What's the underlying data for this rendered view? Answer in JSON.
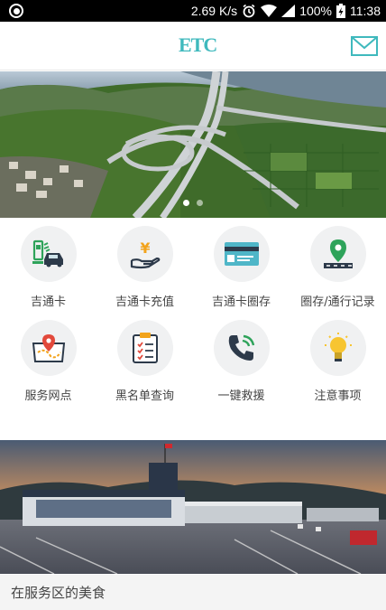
{
  "status_bar": {
    "speed": "2.69 K/s",
    "battery": "100%",
    "time": "11:38"
  },
  "header": {
    "logo": "ETC",
    "mail_icon": "mail-icon"
  },
  "banner": {
    "slides": 2,
    "active_slide": 1
  },
  "grid": [
    {
      "label": "吉通卡",
      "icon": "etc-card-car-icon"
    },
    {
      "label": "吉通卡充值",
      "icon": "yen-hand-icon"
    },
    {
      "label": "吉通卡圈存",
      "icon": "card-icon"
    },
    {
      "label": "圈存/通行记录",
      "icon": "map-pin-road-icon"
    },
    {
      "label": "服务网点",
      "icon": "map-location-icon"
    },
    {
      "label": "黑名单查询",
      "icon": "clipboard-checklist-icon"
    },
    {
      "label": "一键救援",
      "icon": "phone-call-icon"
    },
    {
      "label": "注意事项",
      "icon": "lightbulb-icon"
    }
  ],
  "bottom": {
    "title": "在服务区的美食"
  },
  "colors": {
    "accent": "#3fb9bd",
    "icon_bg": "#f0f1f2"
  }
}
